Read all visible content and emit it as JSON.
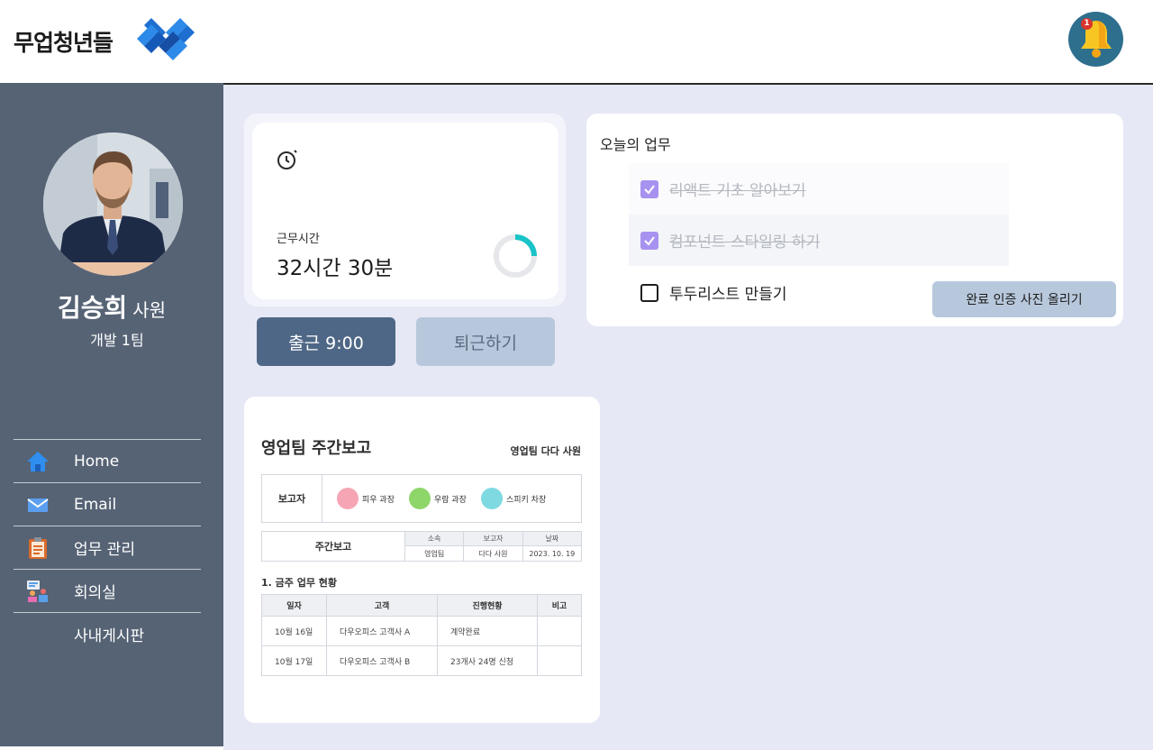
{
  "header": {
    "logo_text": "무업청년들",
    "notification_count": "1"
  },
  "profile": {
    "name": "김승희",
    "rank": "사원",
    "team": "개발 1팀"
  },
  "nav": {
    "items": [
      {
        "label": "Home",
        "icon": "home-icon"
      },
      {
        "label": "Email",
        "icon": "mail-icon"
      },
      {
        "label": "업무 관리",
        "icon": "clipboard-icon"
      },
      {
        "label": "회의실",
        "icon": "meeting-icon"
      },
      {
        "label": "사내게시판",
        "icon": ""
      }
    ]
  },
  "work": {
    "label": "근무시간",
    "time": "32시간 30분",
    "progress": 0.25
  },
  "attendance": {
    "clock_in": "출근 9:00",
    "clock_out": "퇴근하기"
  },
  "todo": {
    "title": "오늘의 업무",
    "items": [
      {
        "text": "리액트 기초 알아보기",
        "done": true
      },
      {
        "text": "컴포넌트 스타일링 하기",
        "done": true
      },
      {
        "text": "투두리스트 만들기",
        "done": false
      }
    ],
    "upload_label": "완료 인증 사진 올리기"
  },
  "report": {
    "title": "영업팀 주간보고",
    "subtitle": "영업팀 다다 사원",
    "reporter_label": "보고자",
    "reporters": [
      "피우 과장",
      "우람 과장",
      "스피키 차장"
    ],
    "weekly_label": "주간보고",
    "meta": [
      {
        "h": "소속",
        "v": "영업팀"
      },
      {
        "h": "보고자",
        "v": "다다 사원"
      },
      {
        "h": "날짜",
        "v": "2023. 10. 19"
      }
    ],
    "section": "1. 금주 업무 현황",
    "columns": [
      "일자",
      "고객",
      "진행현황",
      "비고"
    ],
    "rows": [
      [
        "10월 16일",
        "다우오피스 고객사 A",
        "계약완료",
        ""
      ],
      [
        "10월 17일",
        "다우오피스 고객사 B",
        "23개사 24명 신청",
        ""
      ]
    ]
  }
}
